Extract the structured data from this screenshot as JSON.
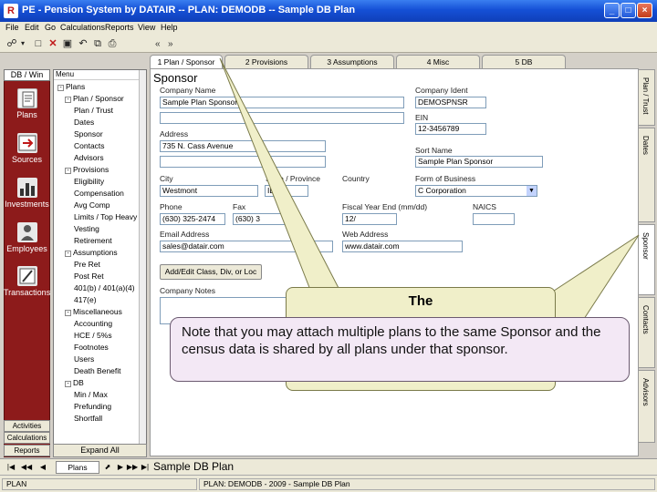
{
  "window": {
    "app_icon": "R",
    "title": "PE - Pension System by DATAIR -- PLAN: DEMODB -- Sample DB Plan",
    "buttons": [
      "_",
      "□",
      "×"
    ]
  },
  "menu": [
    "File",
    "Edit",
    "Go",
    "Calculations",
    "Reports",
    "View",
    "Help"
  ],
  "toolbar": {
    "icons": [
      "binoculars-icon",
      "dropdown-icon",
      "new-icon",
      "delete-icon",
      "save-icon",
      "undo-icon",
      "copy-icon",
      "print-icon"
    ],
    "back": "«",
    "forward": "»"
  },
  "nav": {
    "header": "DB / Win",
    "items": [
      {
        "label": "Plans",
        "icon": "plans-icon"
      },
      {
        "label": "Sources",
        "icon": "sources-icon"
      },
      {
        "label": "Investments",
        "icon": "investments-icon"
      },
      {
        "label": "Employees",
        "icon": "employees-icon"
      },
      {
        "label": "Transactions",
        "icon": "transactions-icon"
      }
    ],
    "bottom": [
      "Activities",
      "Calculations",
      "Reports"
    ]
  },
  "tree": {
    "header": "Menu",
    "rows": [
      {
        "label": "Plans",
        "level": 0,
        "expander": "-"
      },
      {
        "label": "Plan / Sponsor",
        "level": 1,
        "expander": "-"
      },
      {
        "label": "Plan / Trust",
        "level": 2
      },
      {
        "label": "Dates",
        "level": 2
      },
      {
        "label": "Sponsor",
        "level": 2
      },
      {
        "label": "Contacts",
        "level": 2
      },
      {
        "label": "Advisors",
        "level": 2
      },
      {
        "label": "Provisions",
        "level": 1,
        "expander": "-"
      },
      {
        "label": "Eligibility",
        "level": 2
      },
      {
        "label": "Compensation",
        "level": 2
      },
      {
        "label": "Avg Comp",
        "level": 2
      },
      {
        "label": "Limits / Top Heavy",
        "level": 2
      },
      {
        "label": "Vesting",
        "level": 2
      },
      {
        "label": "Retirement",
        "level": 2
      },
      {
        "label": "Assumptions",
        "level": 1,
        "expander": "-"
      },
      {
        "label": "Pre Ret",
        "level": 2
      },
      {
        "label": "Post Ret",
        "level": 2
      },
      {
        "label": "401(b) / 401(a)(4)",
        "level": 2
      },
      {
        "label": "417(e)",
        "level": 2
      },
      {
        "label": "Miscellaneous",
        "level": 1,
        "expander": "-"
      },
      {
        "label": "Accounting",
        "level": 2
      },
      {
        "label": "HCE / 5%s",
        "level": 2
      },
      {
        "label": "Footnotes",
        "level": 2
      },
      {
        "label": "Users",
        "level": 2
      },
      {
        "label": "Death Benefit",
        "level": 2
      },
      {
        "label": "DB",
        "level": 1,
        "expander": "-"
      },
      {
        "label": "Min / Max",
        "level": 2
      },
      {
        "label": "Prefunding",
        "level": 2
      },
      {
        "label": "Shortfall",
        "level": 2
      }
    ],
    "footer": "Expand All"
  },
  "tabs": [
    "1 Plan / Sponsor",
    "2 Provisions",
    "3 Assumptions",
    "4 Misc",
    "5 DB"
  ],
  "side_tabs": [
    "Plan / Trust",
    "Dates",
    "Sponsor",
    "Contacts",
    "Advisors"
  ],
  "form": {
    "section": "Sponsor",
    "company_name_label": "Company Name",
    "company_name": "Sample Plan Sponsor",
    "company_name_2": "",
    "company_ident_label": "Company Ident",
    "company_ident": "DEMOSPNSR",
    "ein_label": "EIN",
    "ein": "12-3456789",
    "address_label": "Address",
    "address": "735 N. Cass Avenue",
    "address_2": "",
    "sort_name_label": "Sort Name",
    "sort_name": "Sample Plan Sponsor",
    "city_label": "City",
    "city": "Westmont",
    "state_label": "State / Province",
    "state": "IL",
    "country_label": "Country",
    "form_of_business_label": "Form of Business",
    "form_of_business": "C Corporation",
    "phone_label": "Phone",
    "phone": "(630) 325-2474",
    "fax_label": "Fax",
    "fax": "(630) 3",
    "fiscal_year_label": "Fiscal Year End (mm/dd)",
    "fiscal_year": "12/",
    "naics_label": "NAICS",
    "email_label": "Email Address",
    "email": "sales@datair.com",
    "web_label": "Web Address",
    "web": "www.datair.com",
    "add_edit_button": "Add/Edit Class, Div, or Loc",
    "notes_label": "Company Notes"
  },
  "record_nav": {
    "buttons": [
      "|◀",
      "◀◀",
      "◀"
    ],
    "field": "Plans",
    "buttons_right": [
      "⬈",
      "▶",
      "▶▶",
      "▶|"
    ]
  },
  "plan_caption": "Sample DB Plan",
  "status": {
    "left": "PLAN",
    "middle": "PLAN: DEMODB - 2009 - Sample DB Plan"
  },
  "callout_back": {
    "text": "The"
  },
  "callout_front": {
    "text": "Note that you may attach multiple plans to the same Sponsor and the census data is shared by all plans under that sponsor."
  },
  "colors": {
    "nav_panel": "#8d1b1b",
    "title_bar": "#1550d6",
    "callout_yellow": "#f0efc9",
    "callout_pink": "#f3e8f5"
  }
}
